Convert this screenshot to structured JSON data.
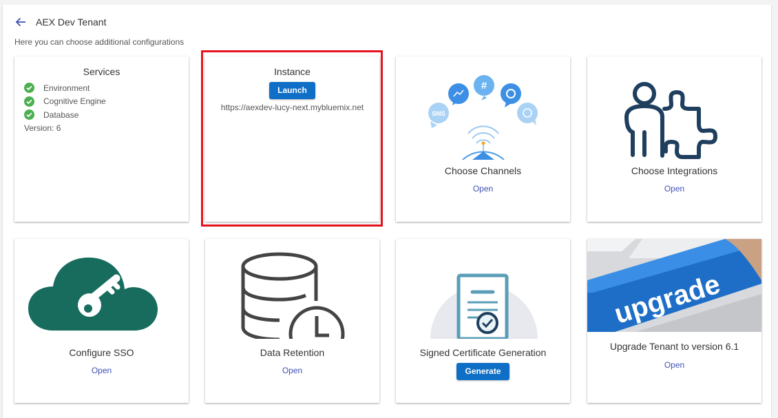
{
  "header": {
    "title": "AEX Dev Tenant",
    "subtitle": "Here you can choose additional configurations"
  },
  "services": {
    "title": "Services",
    "items": [
      "Environment",
      "Cognitive Engine",
      "Database"
    ],
    "version": "Version: 6",
    "status_color": "#4caf50"
  },
  "instance": {
    "title": "Instance",
    "launch_label": "Launch",
    "url": "https://aexdev-lucy-next.mybluemix.net"
  },
  "channels": {
    "title": "Choose Channels",
    "action": "Open",
    "sms_label": "SMS",
    "hash_label": "#"
  },
  "integrations": {
    "title": "Choose Integrations",
    "action": "Open"
  },
  "sso": {
    "title": "Configure SSO",
    "action": "Open"
  },
  "retention": {
    "title": "Data Retention",
    "action": "Open"
  },
  "certificate": {
    "title": "Signed Certificate Generation",
    "action": "Generate"
  },
  "upgrade": {
    "title": "Upgrade Tenant to version 6.1",
    "action": "Open",
    "image_text": "upgrade"
  },
  "colors": {
    "accent": "#0f6fc6",
    "link": "#3f51b5",
    "highlight": "#e5121e",
    "sso_icon": "#176c5e"
  }
}
